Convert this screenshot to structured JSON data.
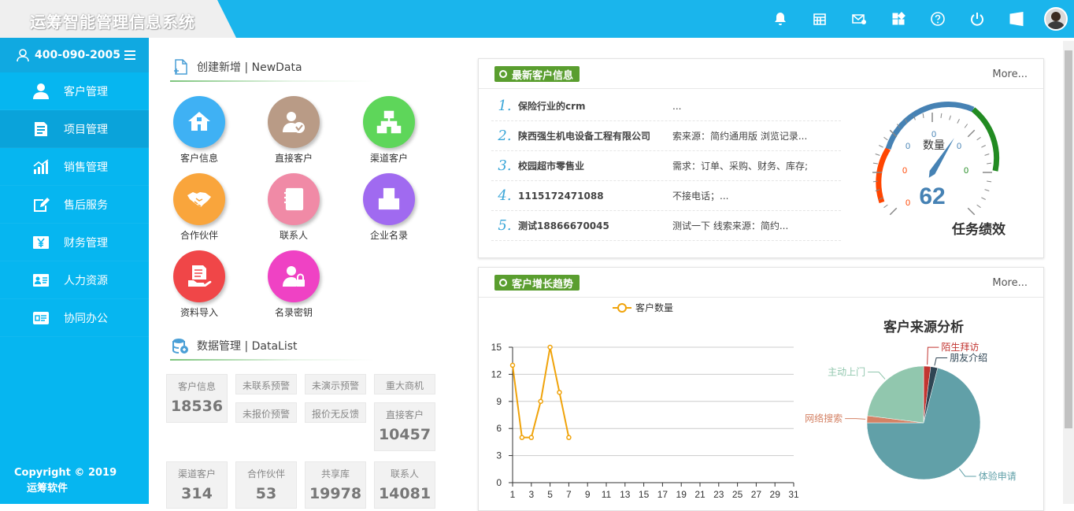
{
  "app": {
    "title": "运筹智能管理信息系统"
  },
  "topbar": {
    "icons": [
      "bell-icon",
      "calendar-icon",
      "mail-icon",
      "apps-icon",
      "help-icon",
      "power-icon",
      "windows-icon"
    ],
    "accent": "#1ab5ec"
  },
  "sidebar": {
    "phone": "400-090-2005",
    "items": [
      {
        "label": "客户管理",
        "icon": "user-icon"
      },
      {
        "label": "项目管理",
        "icon": "document-icon"
      },
      {
        "label": "销售管理",
        "icon": "chart-icon"
      },
      {
        "label": "售后服务",
        "icon": "edit-icon"
      },
      {
        "label": "财务管理",
        "icon": "yen-icon"
      },
      {
        "label": "人力资源",
        "icon": "id-card-icon"
      },
      {
        "label": "协同办公",
        "icon": "office-icon"
      }
    ],
    "copyright": "Copyright © 2019",
    "company": "运筹软件"
  },
  "newdata": {
    "title": "创建新增 | NewData",
    "items": [
      {
        "label": "客户信息",
        "color": "#3fb1f4",
        "icon": "home-icon"
      },
      {
        "label": "直接客户",
        "color": "#b99b86",
        "icon": "user-check-icon"
      },
      {
        "label": "渠道客户",
        "color": "#5ed65a",
        "icon": "sitemap-icon"
      },
      {
        "label": "合作伙伴",
        "color": "#f9a53c",
        "icon": "handshake-icon"
      },
      {
        "label": "联系人",
        "color": "#f08aa6",
        "icon": "contact-book-icon"
      },
      {
        "label": "企业名录",
        "color": "#a06af0",
        "icon": "grid-icon"
      },
      {
        "label": "资料导入",
        "color": "#f04648",
        "icon": "import-icon"
      },
      {
        "label": "名录密钥",
        "color": "#ef42c4",
        "icon": "user-lock-icon"
      }
    ]
  },
  "datalist": {
    "title": "数据管理 | DataList",
    "cells": {
      "c1": {
        "label": "客户信息",
        "value": "18536"
      },
      "c2": {
        "label": "未联系预警"
      },
      "c3": {
        "label": "未演示预警"
      },
      "c4": {
        "label": "重大商机"
      },
      "c5": {
        "label": "未报价预警"
      },
      "c6": {
        "label": "报价无反馈"
      },
      "c7": {
        "label": "直接客户",
        "value": "10457"
      },
      "c8": {
        "label": "渠道客户",
        "value": "314"
      },
      "c9": {
        "label": "合作伙伴",
        "value": "53"
      },
      "c10": {
        "label": "共享库",
        "value": "19978"
      },
      "c11": {
        "label": "联系人",
        "value": "14081"
      }
    }
  },
  "latest": {
    "title": "最新客户信息",
    "more": "More...",
    "rows": [
      {
        "no": "1.",
        "name": "保险行业的crm",
        "desc": "..."
      },
      {
        "no": "2.",
        "name": "陕西强生机电设备工程有限公司",
        "desc": "索来源：简约通用版 浏览记录..."
      },
      {
        "no": "3.",
        "name": "校园超市零售业",
        "desc": "需求：订单、采购、财务、库存;"
      },
      {
        "no": "4.",
        "name": "1115172471088",
        "desc": "不接电话；..."
      },
      {
        "no": "5.",
        "name": "测试18866670045",
        "desc": "测试一下 线索来源：简约..."
      }
    ],
    "gauge": {
      "label": "数量",
      "value": "62",
      "title": "任务绩效",
      "ticks": [
        "0",
        "0",
        "0",
        "0",
        "0",
        "0",
        "0"
      ],
      "value_num": 62
    }
  },
  "trend": {
    "title": "客户增长趋势",
    "more": "More..."
  },
  "chart_data": [
    {
      "type": "line",
      "title": "",
      "legend": "客户数量",
      "series": [
        {
          "name": "客户数量",
          "color": "#f0a30a",
          "x": [
            1,
            2,
            3,
            4,
            5,
            6,
            7
          ],
          "values": [
            13,
            5,
            5,
            9,
            15,
            10,
            5
          ]
        }
      ],
      "x_ticks": [
        "1",
        "3",
        "5",
        "7",
        "9",
        "11",
        "13",
        "15",
        "17",
        "19",
        "21",
        "23",
        "25",
        "27",
        "29",
        "31"
      ],
      "y_ticks": [
        "0",
        "3",
        "6",
        "9",
        "12",
        "15"
      ],
      "xlim": [
        1,
        31
      ],
      "ylim": [
        0,
        15
      ],
      "grid": true,
      "legend_position": "top"
    },
    {
      "type": "pie",
      "title": "客户来源分析",
      "slices": [
        {
          "label": "陌生拜访",
          "value": 2,
          "color": "#c23531"
        },
        {
          "label": "朋友介绍",
          "value": 2,
          "color": "#2f4554"
        },
        {
          "label": "体验申请",
          "value": 71,
          "color": "#61a0a8"
        },
        {
          "label": "网络搜索",
          "value": 2,
          "color": "#d48265"
        },
        {
          "label": "主动上门",
          "value": 23,
          "color": "#91c7ae"
        }
      ]
    }
  ]
}
